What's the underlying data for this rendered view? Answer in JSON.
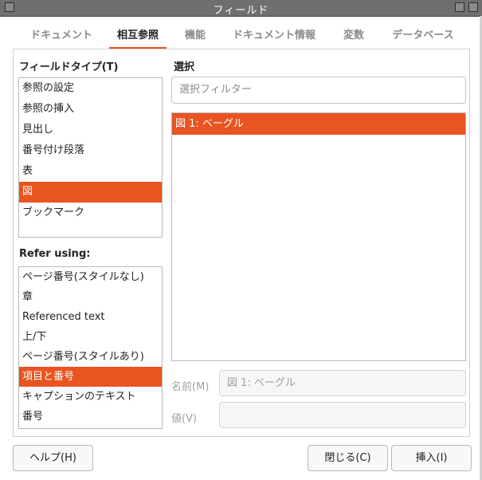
{
  "window": {
    "title": "フィールド"
  },
  "tabs": [
    {
      "label": "ドキュメント",
      "active": false
    },
    {
      "label": "相互参照",
      "active": true
    },
    {
      "label": "機能",
      "active": false
    },
    {
      "label": "ドキュメント情報",
      "active": false
    },
    {
      "label": "変数",
      "active": false
    },
    {
      "label": "データベース",
      "active": false
    }
  ],
  "field_type": {
    "heading": "フィールドタイプ(T)",
    "items": [
      "参照の設定",
      "参照の挿入",
      "見出し",
      "番号付け段落",
      "表",
      "図",
      "ブックマーク"
    ],
    "selected": "図"
  },
  "refer_using": {
    "heading": "Refer using:",
    "items": [
      "ページ番号(スタイルなし)",
      "章",
      "Referenced text",
      "上/下",
      "ページ番号(スタイルあり)",
      "項目と番号",
      "キャプションのテキスト",
      "番号"
    ],
    "selected": "項目と番号"
  },
  "selection": {
    "heading": "選択",
    "filter_placeholder": "選択フィルター",
    "items": [
      "図 1: ベーグル"
    ],
    "selected": "図 1: ベーグル"
  },
  "name_field": {
    "label": "名前(M)",
    "value": "図 1: ベーグル"
  },
  "value_field": {
    "label": "値(V)",
    "value": ""
  },
  "buttons": {
    "help": "ヘルプ(H)",
    "close": "閉じる(C)",
    "insert": "挿入(I)"
  },
  "colors": {
    "accent": "#e95420",
    "titlebar": "#6f6f6f"
  }
}
